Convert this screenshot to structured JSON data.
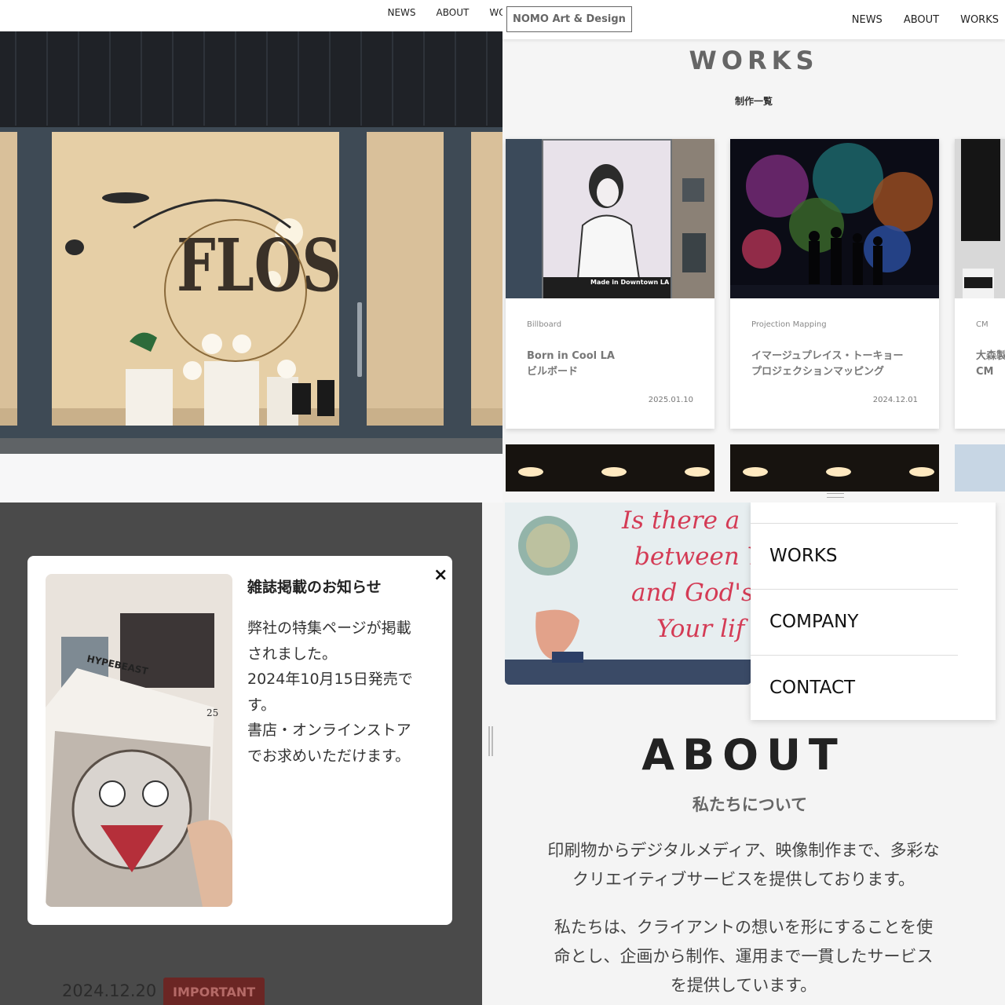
{
  "top_left": {
    "nav": [
      "NEWS",
      "ABOUT",
      "WOR"
    ],
    "hero_alt": "FLOS"
  },
  "works_page": {
    "logo": "NOMO Art & Design",
    "nav": [
      "NEWS",
      "ABOUT",
      "WORKS"
    ],
    "title": "WORKS",
    "subtitle": "制作一覧",
    "cards": [
      {
        "category": "Billboard",
        "title_line1": "Born in Cool LA",
        "title_line2": "ビルボード",
        "date": "2025.01.10",
        "sign": "Made in Downtown LA"
      },
      {
        "category": "Projection Mapping",
        "title_line1": "イマージュプレイス・トーキョー",
        "title_line2": "プロジェクションマッピング",
        "date": "2024.12.01"
      },
      {
        "category": "CM",
        "title_line1": "大森製",
        "title_line2": "CM",
        "date": ""
      }
    ]
  },
  "modal": {
    "title": "雑誌掲載のお知らせ",
    "body_lines": [
      "弊社の特集ページが掲載",
      "されました。",
      "2024年10月15日発売で",
      "す。",
      "書店・オンラインストア",
      "でお求めいただけます。"
    ],
    "close": "×",
    "magazine_name": "HYPEBEAST",
    "magazine_number": "25"
  },
  "news_item": {
    "date": "2024.12.20",
    "badge": "IMPORTANT"
  },
  "about_page": {
    "menu": [
      "WORKS",
      "COMPANY",
      "CONTACT"
    ],
    "whiteboard_lines": [
      "Is there a",
      "between Yo",
      "and God's pl",
      "Your lif"
    ],
    "title": "ABOUT",
    "subtitle": "私たちについて",
    "para1": [
      "印刷物からデジタルメディア、映像制作まで、多彩な",
      "クリエイティブサービスを提供しております。"
    ],
    "para2": [
      "私たちは、クライアントの想いを形にすることを使",
      "命とし、企画から制作、運用まで一貫したサービス",
      "を提供しています。"
    ]
  }
}
